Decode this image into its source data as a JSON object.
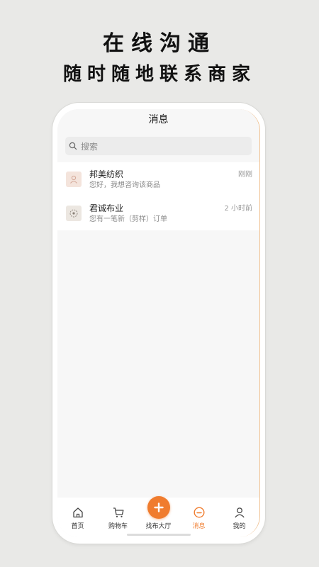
{
  "promo": {
    "line1": "在线沟通",
    "line2": "随时随地联系商家"
  },
  "header": {
    "title": "消息"
  },
  "search": {
    "placeholder": "搜索"
  },
  "conversations": [
    {
      "name": "邦美纺织",
      "preview": "您好，我想咨询该商品",
      "time": "刚刚",
      "avatar_icon": "textile-logo-icon"
    },
    {
      "name": "君诚布业",
      "preview": "您有一笔新（剪样）订单",
      "time": "2 小时前",
      "avatar_icon": "fabric-logo-icon"
    }
  ],
  "tabbar": {
    "items": [
      {
        "label": "首页",
        "icon": "home-icon"
      },
      {
        "label": "购物车",
        "icon": "cart-icon"
      },
      {
        "label": "找布大厅",
        "icon": "plus-icon"
      },
      {
        "label": "消息",
        "icon": "message-icon",
        "active": true
      },
      {
        "label": "我的",
        "icon": "user-icon"
      }
    ]
  },
  "colors": {
    "accent": "#f07c2e",
    "background": "#e9e9e7"
  }
}
